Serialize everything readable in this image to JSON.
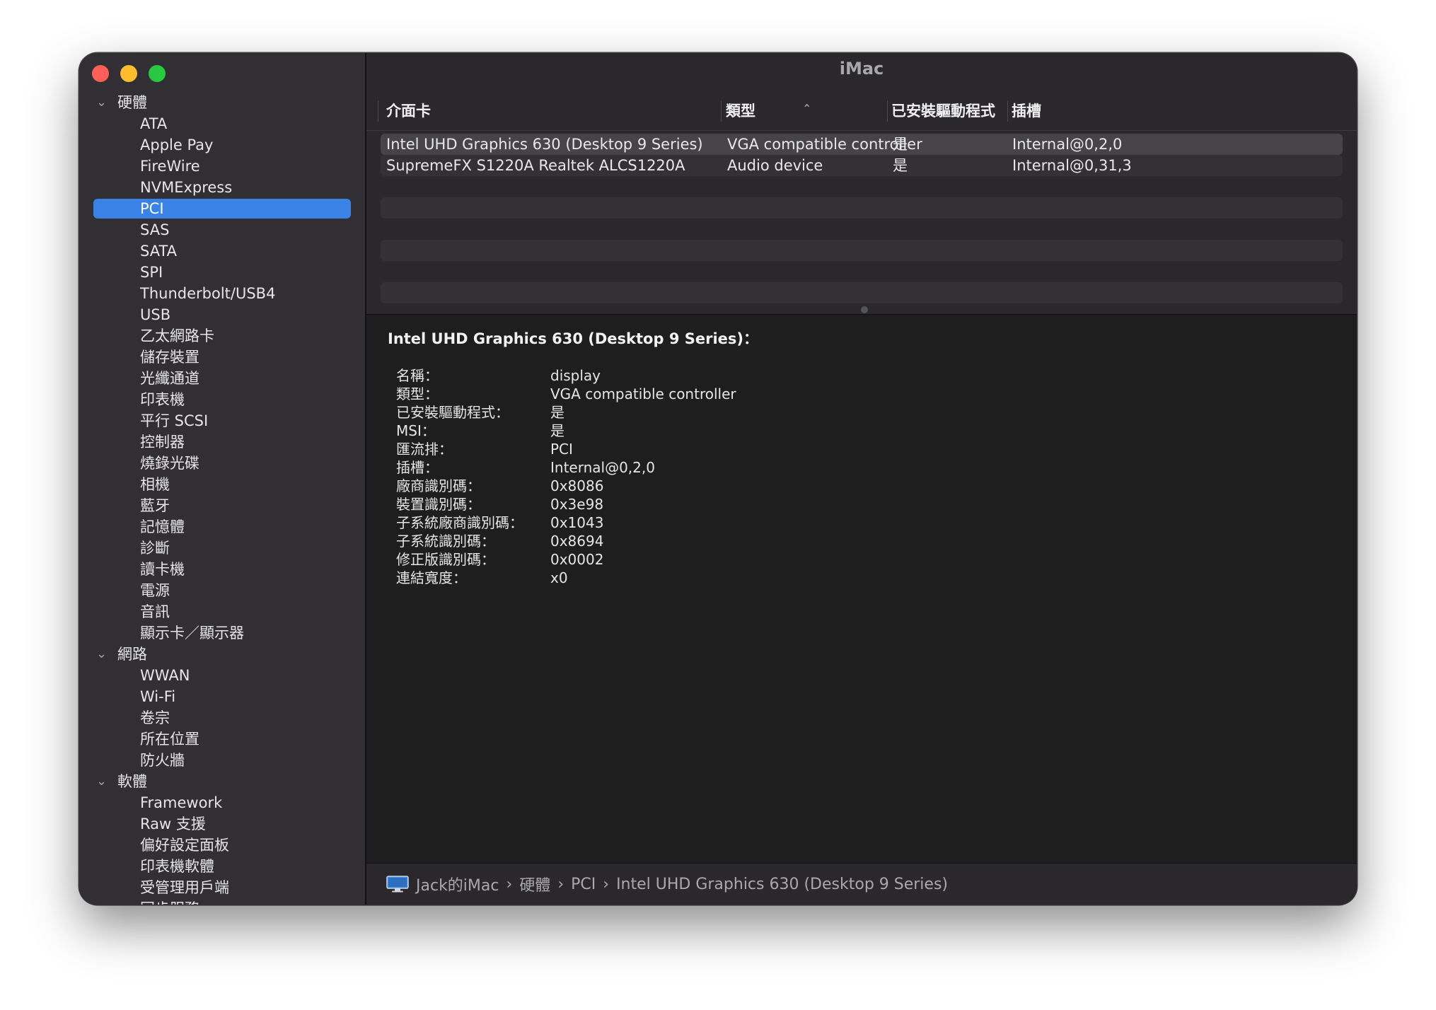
{
  "window": {
    "title": "iMac"
  },
  "sidebar": {
    "groups": [
      {
        "label": "硬體",
        "items": [
          "ATA",
          "Apple Pay",
          "FireWire",
          "NVMExpress",
          "PCI",
          "SAS",
          "SATA",
          "SPI",
          "Thunderbolt/USB4",
          "USB",
          "乙太網路卡",
          "儲存裝置",
          "光纖通道",
          "印表機",
          "平行 SCSI",
          "控制器",
          "燒錄光碟",
          "相機",
          "藍牙",
          "記憶體",
          "診斷",
          "讀卡機",
          "電源",
          "音訊",
          "顯示卡／顯示器"
        ]
      },
      {
        "label": "網路",
        "items": [
          "WWAN",
          "Wi-Fi",
          "卷宗",
          "所在位置",
          "防火牆"
        ]
      },
      {
        "label": "軟體",
        "items": [
          "Framework",
          "Raw 支援",
          "偏好設定面板",
          "印表機軟體",
          "受管理用戶端",
          "同步服務"
        ]
      }
    ],
    "selected": "PCI"
  },
  "table": {
    "columns": [
      "介面卡",
      "類型",
      "已安裝驅動程式",
      "插槽"
    ],
    "rows": [
      [
        "Intel UHD Graphics 630 (Desktop 9 Series)",
        "VGA compatible controller",
        "是",
        "Internal@0,2,0"
      ],
      [
        "SupremeFX S1220A Realtek ALCS1220A",
        "Audio device",
        "是",
        "Internal@0,31,3"
      ]
    ]
  },
  "detail": {
    "title": "Intel UHD Graphics 630 (Desktop 9 Series)：",
    "properties": [
      {
        "key": "名稱：",
        "value": "display"
      },
      {
        "key": "類型：",
        "value": "VGA compatible controller"
      },
      {
        "key": "已安裝驅動程式：",
        "value": "是"
      },
      {
        "key": "MSI：",
        "value": "是"
      },
      {
        "key": "匯流排：",
        "value": "PCI"
      },
      {
        "key": "插槽：",
        "value": "Internal@0,2,0"
      },
      {
        "key": "廠商識別碼：",
        "value": "0x8086"
      },
      {
        "key": "裝置識別碼：",
        "value": "0x3e98"
      },
      {
        "key": "子系統廠商識別碼：",
        "value": "0x1043"
      },
      {
        "key": "子系統識別碼：",
        "value": "0x8694"
      },
      {
        "key": "修正版識別碼：",
        "value": "0x0002"
      },
      {
        "key": "連結寬度：",
        "value": "x0"
      }
    ]
  },
  "pathbar": {
    "icon": "imac-icon",
    "crumbs": [
      "Jack的iMac",
      "硬體",
      "PCI",
      "Intel UHD Graphics 630 (Desktop 9 Series)"
    ]
  }
}
